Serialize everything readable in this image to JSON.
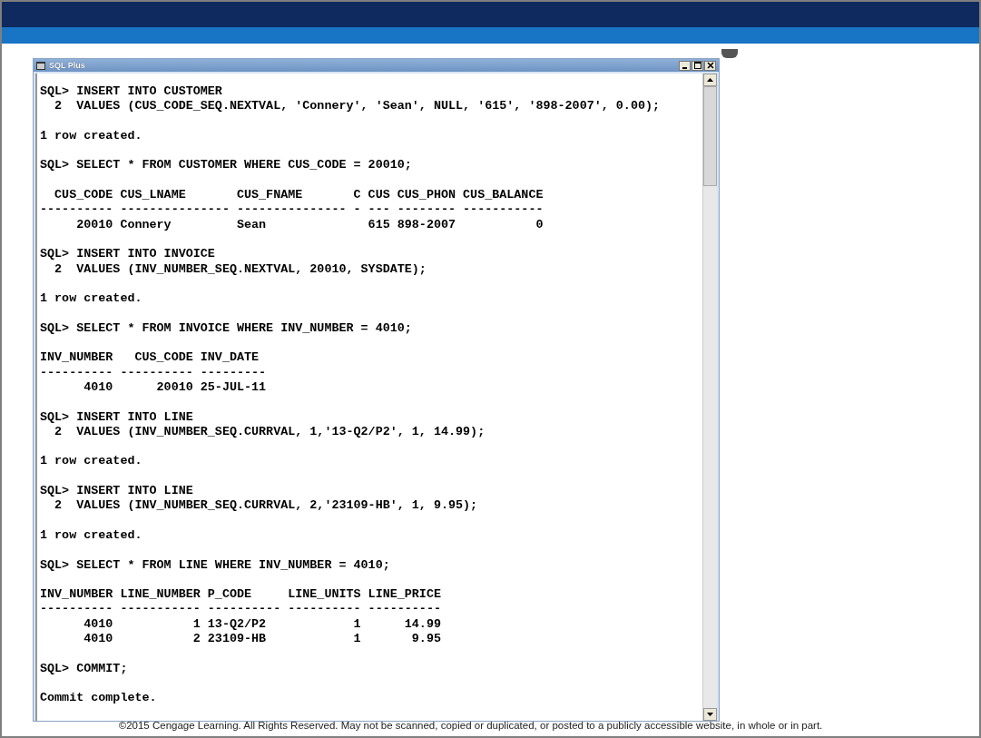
{
  "window": {
    "title": "SQL Plus"
  },
  "console": {
    "blocks": [
      [
        "SQL> INSERT INTO CUSTOMER",
        "  2  VALUES (CUS_CODE_SEQ.NEXTVAL, 'Connery', 'Sean', NULL, '615', '898-2007', 0.00);"
      ],
      [
        "1 row created."
      ],
      [
        "SQL> SELECT * FROM CUSTOMER WHERE CUS_CODE = 20010;"
      ],
      [
        "  CUS_CODE CUS_LNAME       CUS_FNAME       C CUS CUS_PHON CUS_BALANCE",
        "---------- --------------- --------------- - --- -------- -----------",
        "     20010 Connery         Sean              615 898-2007           0"
      ],
      [
        "SQL> INSERT INTO INVOICE",
        "  2  VALUES (INV_NUMBER_SEQ.NEXTVAL, 20010, SYSDATE);"
      ],
      [
        "1 row created."
      ],
      [
        "SQL> SELECT * FROM INVOICE WHERE INV_NUMBER = 4010;"
      ],
      [
        "INV_NUMBER   CUS_CODE INV_DATE",
        "---------- ---------- ---------",
        "      4010      20010 25-JUL-11"
      ],
      [
        "SQL> INSERT INTO LINE",
        "  2  VALUES (INV_NUMBER_SEQ.CURRVAL, 1,'13-Q2/P2', 1, 14.99);"
      ],
      [
        "1 row created."
      ],
      [
        "SQL> INSERT INTO LINE",
        "  2  VALUES (INV_NUMBER_SEQ.CURRVAL, 2,'23109-HB', 1, 9.95);"
      ],
      [
        "1 row created."
      ],
      [
        "SQL> SELECT * FROM LINE WHERE INV_NUMBER = 4010;"
      ],
      [
        "INV_NUMBER LINE_NUMBER P_CODE     LINE_UNITS LINE_PRICE",
        "---------- ----------- ---------- ---------- ----------",
        "      4010           1 13-Q2/P2            1      14.99",
        "      4010           2 23109-HB            1       9.95"
      ],
      [
        "SQL> COMMIT;"
      ],
      [
        "Commit complete."
      ]
    ]
  },
  "footer": "©2015 Cengage Learning. All Rights Reserved. May not be scanned, copied or duplicated, or posted to a publicly accessible website, in whole or in part."
}
